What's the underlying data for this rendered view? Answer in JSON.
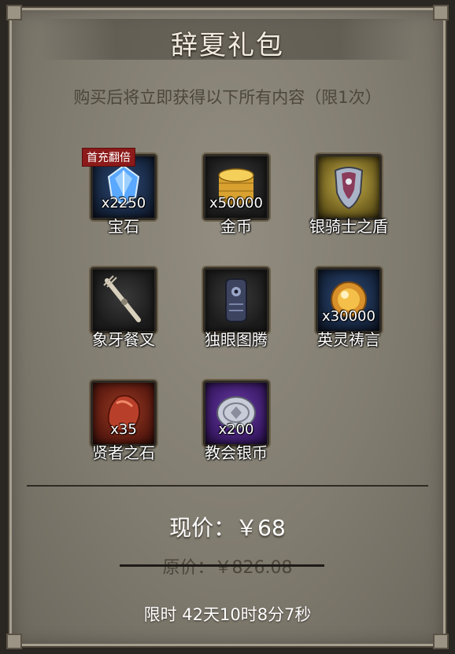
{
  "title": "辞夏礼包",
  "subtitle": "购买后将立即获得以下所有内容（限1次）",
  "badge_first_recharge": "首充翻倍",
  "items": [
    {
      "name": "宝石",
      "qty": "x2250",
      "icon": "gem-icon",
      "rarity_color": "#2d4a78"
    },
    {
      "name": "金币",
      "qty": "x50000",
      "icon": "gold-coins-icon",
      "rarity_color": "#3a3a3a"
    },
    {
      "name": "银骑士之盾",
      "qty": "",
      "icon": "shield-icon",
      "rarity_color": "#c7b04a"
    },
    {
      "name": "象牙餐叉",
      "qty": "",
      "icon": "ivory-fork-icon",
      "rarity_color": "#3a3a3a"
    },
    {
      "name": "独眼图腾",
      "qty": "",
      "icon": "totem-icon",
      "rarity_color": "#3a3a3a"
    },
    {
      "name": "英灵祷言",
      "qty": "x30000",
      "icon": "golden-orb-icon",
      "rarity_color": "#2d4a78"
    },
    {
      "name": "贤者之石",
      "qty": "x35",
      "icon": "sage-stone-icon",
      "rarity_color": "#9a3a22"
    },
    {
      "name": "教会银币",
      "qty": "x200",
      "icon": "silver-coin-icon",
      "rarity_color": "#6a3aa8"
    }
  ],
  "price": {
    "current": "现价：￥68",
    "original": "原价：￥826.08"
  },
  "timer": "限时 42天10时8分7秒"
}
